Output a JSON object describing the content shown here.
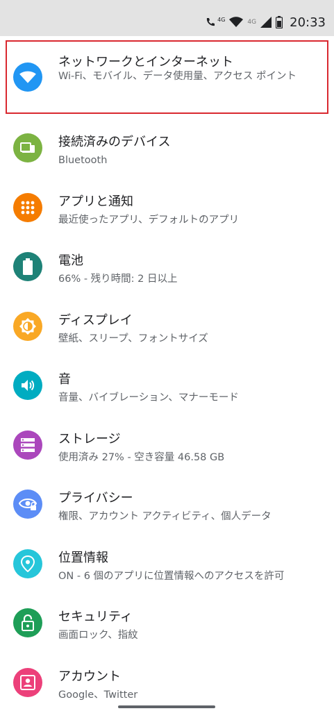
{
  "status_bar": {
    "network_label_1": "4G",
    "network_label_2": "4G",
    "time": "20:33"
  },
  "settings_items": [
    {
      "title": "ネットワークとインターネット",
      "subtitle": "Wi-Fi、モバイル、データ使用量、アクセス ポイント",
      "icon": "wifi-icon",
      "color": "#2196f3"
    },
    {
      "title": "接続済みのデバイス",
      "subtitle": "Bluetooth",
      "icon": "devices-icon",
      "color": "#7cb342"
    },
    {
      "title": "アプリと通知",
      "subtitle": "最近使ったアプリ、デフォルトのアプリ",
      "icon": "apps-grid-icon",
      "color": "#f57c00"
    },
    {
      "title": "電池",
      "subtitle": "66% - 残り時間: 2 日以上",
      "icon": "battery-icon",
      "color": "#1e8277"
    },
    {
      "title": "ディスプレイ",
      "subtitle": "壁紙、スリープ、フォントサイズ",
      "icon": "brightness-icon",
      "color": "#f9a825"
    },
    {
      "title": "音",
      "subtitle": "音量、バイブレーション、マナーモード",
      "icon": "volume-icon",
      "color": "#00acc1"
    },
    {
      "title": "ストレージ",
      "subtitle": "使用済み 27% - 空き容量 46.58 GB",
      "icon": "storage-icon",
      "color": "#ab47bc"
    },
    {
      "title": "プライバシー",
      "subtitle": "権限、アカウント アクティビティ、個人データ",
      "icon": "privacy-eye-icon",
      "color": "#5c8df6"
    },
    {
      "title": "位置情報",
      "subtitle": "ON - 6 個のアプリに位置情報へのアクセスを許可",
      "icon": "location-pin-icon",
      "color": "#26c6da"
    },
    {
      "title": "セキュリティ",
      "subtitle": "画面ロック、指紋",
      "icon": "lock-icon",
      "color": "#1e9e57"
    },
    {
      "title": "アカウント",
      "subtitle": "Google、Twitter",
      "icon": "account-icon",
      "color": "#ec407a"
    }
  ]
}
